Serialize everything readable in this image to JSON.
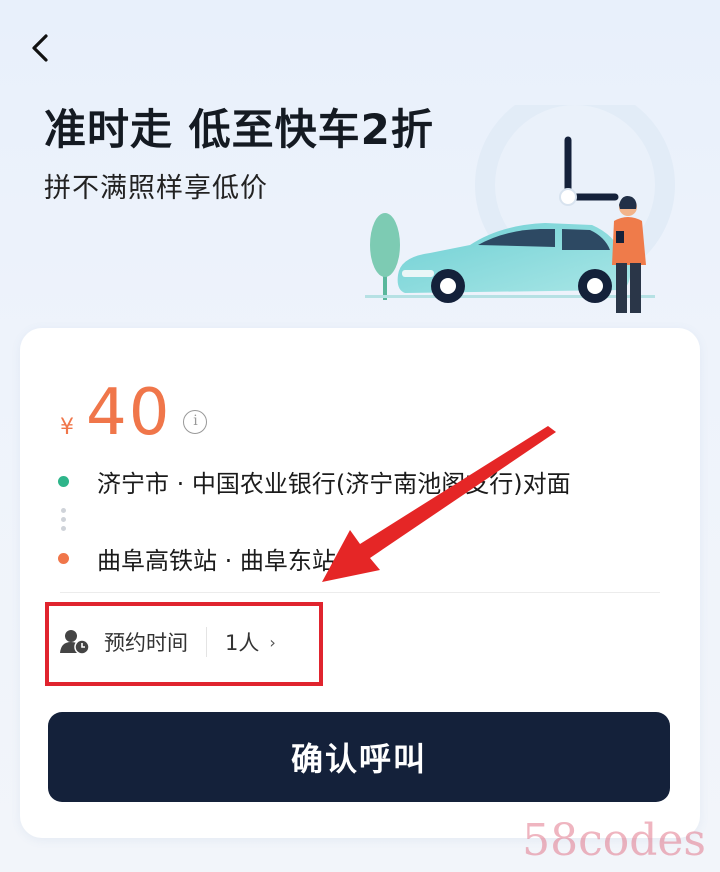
{
  "nav": {
    "back_icon": "chevron-left-icon"
  },
  "hero": {
    "title": "准时走 低至快车2折",
    "subtitle": "拼不满照样享低价"
  },
  "fare": {
    "currency": "¥",
    "amount": "40",
    "info_icon_glyph": "i",
    "color": "#f0764a"
  },
  "route": {
    "origin": "济宁市 · 中国农业银行(济宁南池阁支行)对面",
    "destination": "曲阜高铁站 · 曲阜东站",
    "origin_color": "#2eb58a",
    "destination_color": "#f0764a"
  },
  "options": {
    "time_label": "预约时间",
    "passengers_label": "1人",
    "chevron": "›"
  },
  "confirm": {
    "label": "确认呼叫",
    "color": "#14213a"
  },
  "annotation": {
    "highlight_color": "#e0242e"
  },
  "watermark": "58codes"
}
